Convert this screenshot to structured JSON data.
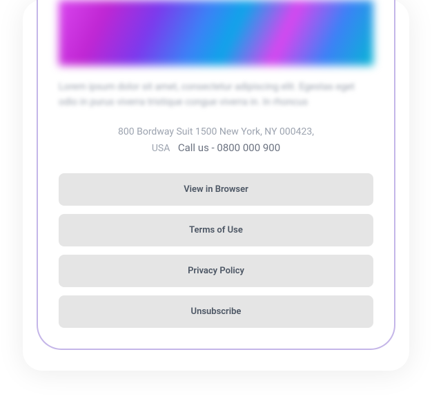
{
  "body_text": "Lorem ipsum dolor sit amet, consectetur adipiscing elit. Egestas eget odio in purus viverra tristique congue viverra in. In rhoncus",
  "footer": {
    "address_line1": "800 Bordway Suit 1500 New York, NY 000423,",
    "address_line2_country": "USA",
    "call_us": "Call us - 0800 000 900"
  },
  "buttons": {
    "view_in_browser": "View in Browser",
    "terms_of_use": "Terms of Use",
    "privacy_policy": "Privacy Policy",
    "unsubscribe": "Unsubscribe"
  }
}
